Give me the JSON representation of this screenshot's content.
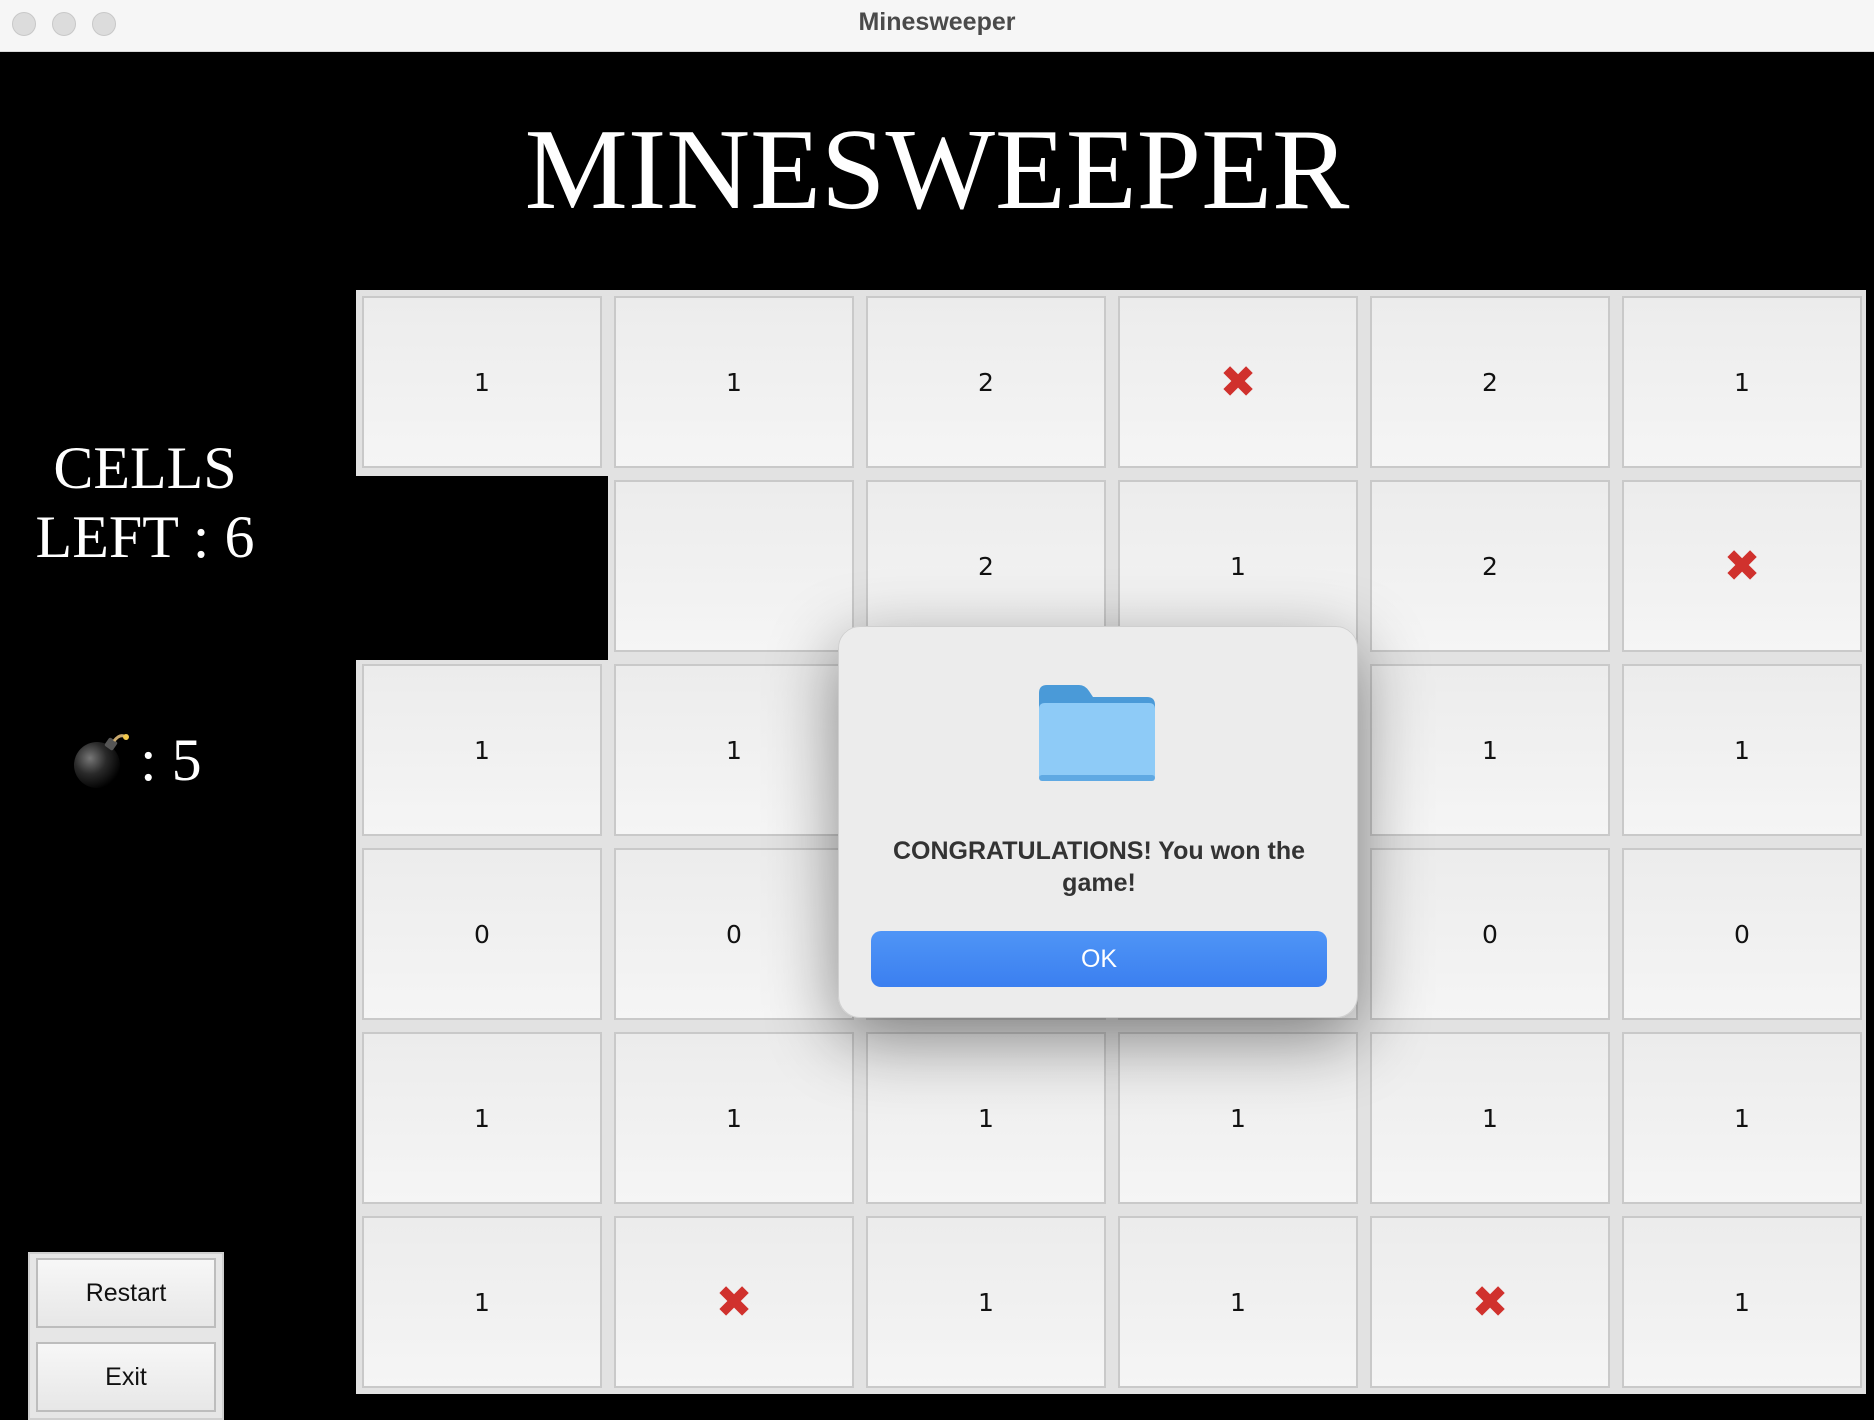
{
  "window": {
    "title": "Minesweeper"
  },
  "game": {
    "title": "MINESWEEPER",
    "cells_left_line1": "CELLS",
    "cells_left_line2": "LEFT : 6",
    "bomb_count": ": 5"
  },
  "side_buttons": {
    "restart": "Restart",
    "exit": "Exit"
  },
  "board": {
    "rows": [
      [
        "1",
        "1",
        "2",
        "✖",
        "2",
        "1"
      ],
      [
        null,
        "",
        "2",
        "1",
        "2",
        "✖"
      ],
      [
        "1",
        "1",
        "",
        "",
        "1",
        "1"
      ],
      [
        "0",
        "0",
        "",
        "",
        "0",
        "0"
      ],
      [
        "1",
        "1",
        "1",
        "1",
        "1",
        "1"
      ],
      [
        "1",
        "✖",
        "1",
        "1",
        "✖",
        "1"
      ]
    ]
  },
  "dialog": {
    "icon": "folder-icon",
    "message": "CONGRATULATIONS! You won the game!",
    "ok_label": "OK"
  },
  "colors": {
    "mark": "#d0312d",
    "ok_button": "#3b82f6"
  }
}
